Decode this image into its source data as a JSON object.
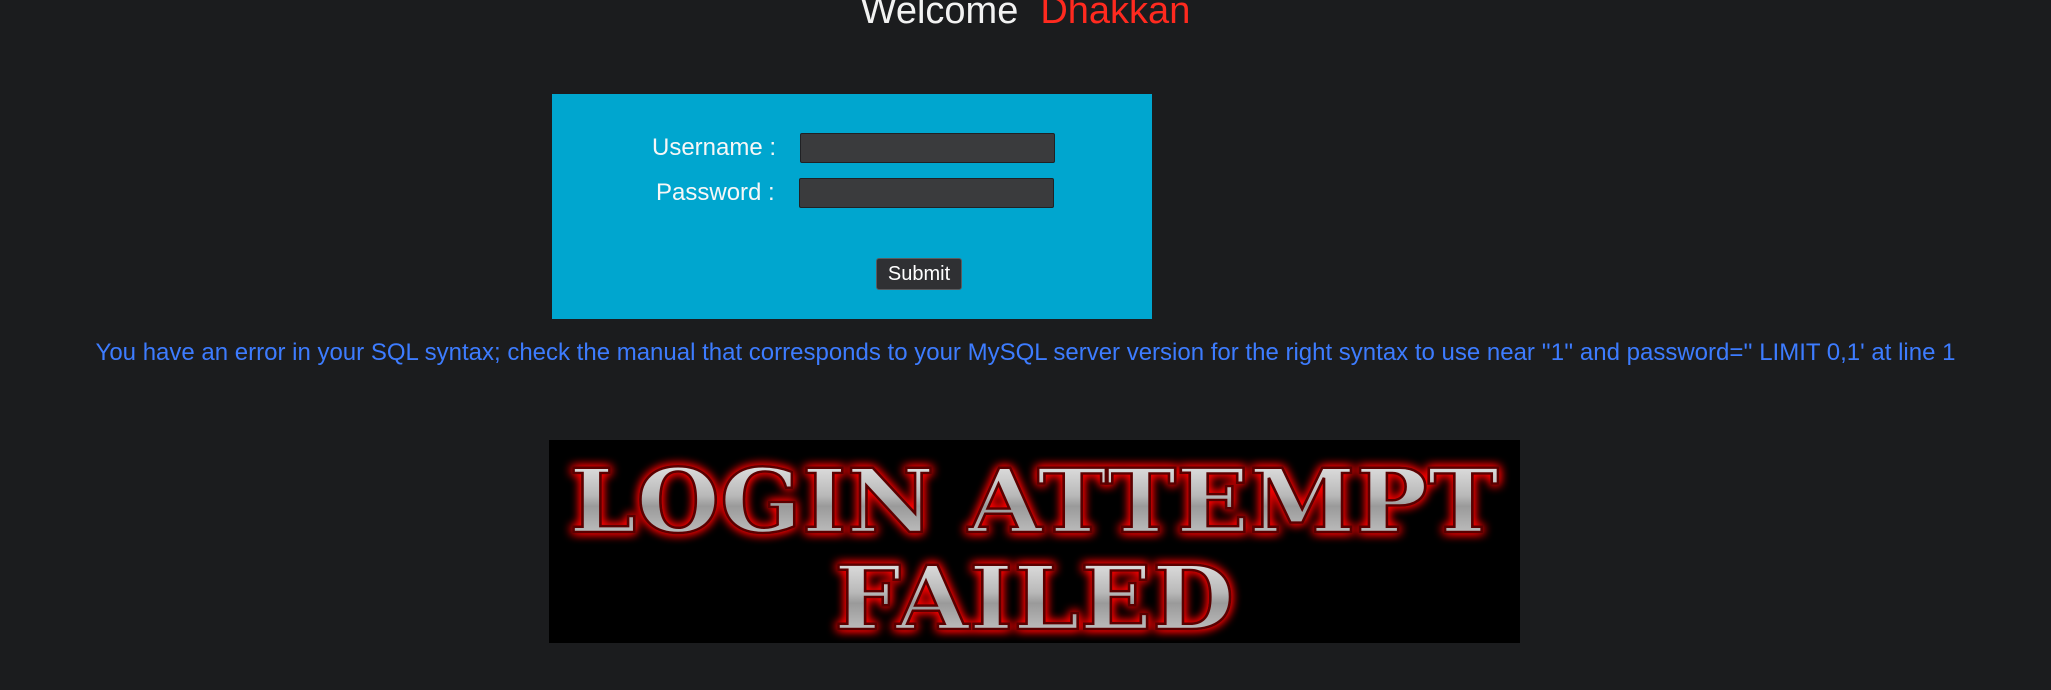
{
  "header": {
    "welcome_text": "Welcome",
    "user_name": "Dhakkan"
  },
  "login_form": {
    "username_label": "Username :",
    "username_value": "",
    "password_label": "Password :",
    "password_value": "",
    "submit_label": "Submit"
  },
  "error_message": "You have an error in your SQL syntax; check the manual that corresponds to your MySQL server version for the right syntax to use near ''1'' and password='' LIMIT 0,1' at line 1",
  "banner": {
    "line1": "LOGIN ATTEMPT",
    "line2": "FAILED"
  },
  "colors": {
    "background": "#1b1c1e",
    "form_panel": "#00a6cf",
    "welcome_name": "#ff2a1f",
    "error_text": "#3d7cff",
    "banner_glow": "#ff0000"
  }
}
